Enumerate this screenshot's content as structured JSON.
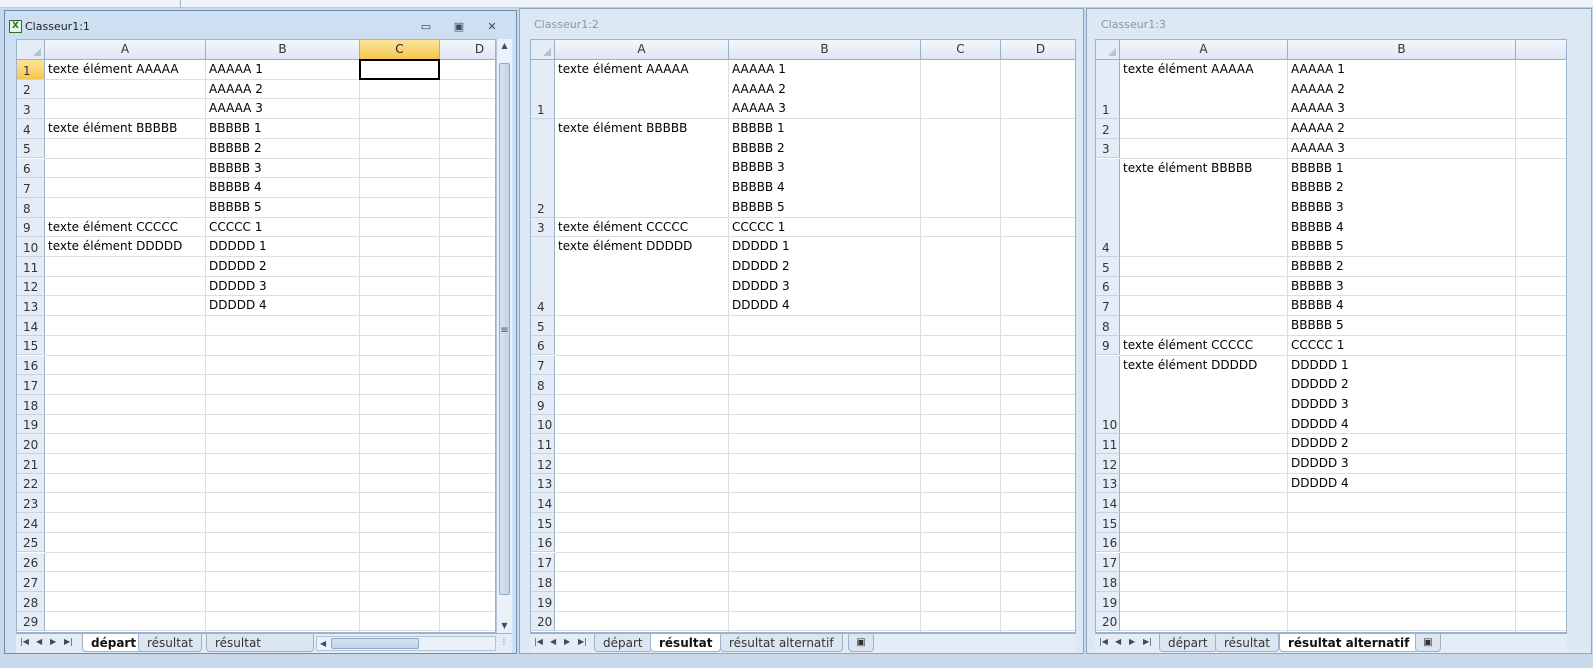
{
  "windows": [
    {
      "title": "Classeur1:1",
      "columns": [
        "A",
        "B",
        "C",
        "D"
      ],
      "rows": [
        "1",
        "2",
        "3",
        "4",
        "5",
        "6",
        "7",
        "8",
        "9",
        "10",
        "11",
        "12",
        "13",
        "14",
        "15",
        "16",
        "17",
        "18",
        "19",
        "20",
        "21",
        "22",
        "23",
        "24",
        "25",
        "26",
        "27",
        "28",
        "29"
      ],
      "cells": [
        {
          "r": 0,
          "c": 0,
          "lines": [
            "texte élément AAAAA"
          ]
        },
        {
          "r": 0,
          "c": 1,
          "lines": [
            "AAAAA 1"
          ]
        },
        {
          "r": 1,
          "c": 1,
          "lines": [
            "AAAAA 2"
          ]
        },
        {
          "r": 2,
          "c": 1,
          "lines": [
            "AAAAA 3"
          ]
        },
        {
          "r": 3,
          "c": 0,
          "lines": [
            "texte élément BBBBB"
          ]
        },
        {
          "r": 3,
          "c": 1,
          "lines": [
            "BBBBB 1"
          ]
        },
        {
          "r": 4,
          "c": 1,
          "lines": [
            "BBBBB 2"
          ]
        },
        {
          "r": 5,
          "c": 1,
          "lines": [
            "BBBBB 3"
          ]
        },
        {
          "r": 6,
          "c": 1,
          "lines": [
            "BBBBB 4"
          ]
        },
        {
          "r": 7,
          "c": 1,
          "lines": [
            "BBBBB 5"
          ]
        },
        {
          "r": 8,
          "c": 0,
          "lines": [
            "texte élément CCCCC"
          ]
        },
        {
          "r": 8,
          "c": 1,
          "lines": [
            "CCCCC 1"
          ]
        },
        {
          "r": 9,
          "c": 0,
          "lines": [
            "texte élément DDDDD"
          ]
        },
        {
          "r": 9,
          "c": 1,
          "lines": [
            "DDDDD 1"
          ]
        },
        {
          "r": 10,
          "c": 1,
          "lines": [
            "DDDDD 2"
          ]
        },
        {
          "r": 11,
          "c": 1,
          "lines": [
            "DDDDD 3"
          ]
        },
        {
          "r": 12,
          "c": 1,
          "lines": [
            "DDDDD 4"
          ]
        }
      ],
      "tabs": [
        "départ",
        "résultat",
        "résultat alternati"
      ],
      "active_tab": 0
    },
    {
      "title": "Classeur1:2",
      "columns": [
        "A",
        "B",
        "C",
        "D"
      ],
      "rows": [
        "1",
        "2",
        "3",
        "4",
        "5",
        "6",
        "7",
        "8",
        "9",
        "10",
        "11",
        "12",
        "13",
        "14",
        "15",
        "16",
        "17",
        "18",
        "19",
        "20"
      ],
      "cells": [
        {
          "r": 0,
          "c": 0,
          "lines": [
            "texte élément AAAAA"
          ]
        },
        {
          "r": 0,
          "c": 1,
          "lines": [
            "AAAAA 1",
            "AAAAA 2",
            "AAAAA 3"
          ]
        },
        {
          "r": 1,
          "c": 0,
          "lines": [
            "texte élément BBBBB"
          ]
        },
        {
          "r": 1,
          "c": 1,
          "lines": [
            "BBBBB 1",
            "BBBBB 2",
            "BBBBB 3",
            "BBBBB 4",
            "BBBBB 5"
          ]
        },
        {
          "r": 2,
          "c": 0,
          "lines": [
            "texte élément CCCCC"
          ]
        },
        {
          "r": 2,
          "c": 1,
          "lines": [
            "CCCCC 1"
          ]
        },
        {
          "r": 3,
          "c": 0,
          "lines": [
            "texte élément DDDDD"
          ]
        },
        {
          "r": 3,
          "c": 1,
          "lines": [
            "DDDDD 1",
            "DDDDD 2",
            "DDDDD 3",
            "DDDDD 4"
          ]
        }
      ],
      "tabs": [
        "départ",
        "résultat",
        "résultat alternatif"
      ],
      "active_tab": 1
    },
    {
      "title": "Classeur1:3",
      "columns": [
        "A",
        "B",
        ""
      ],
      "rows": [
        "1",
        "2",
        "3",
        "4",
        "5",
        "6",
        "7",
        "8",
        "9",
        "10",
        "11",
        "12",
        "13",
        "14",
        "15",
        "16",
        "17",
        "18",
        "19",
        "20"
      ],
      "cells": [
        {
          "r": 0,
          "c": 0,
          "lines": [
            "texte élément AAAAA"
          ]
        },
        {
          "r": 0,
          "c": 1,
          "lines": [
            "AAAAA 1",
            "AAAAA 2",
            "AAAAA 3"
          ]
        },
        {
          "r": 1,
          "c": 1,
          "lines": [
            "AAAAA 2"
          ]
        },
        {
          "r": 2,
          "c": 1,
          "lines": [
            "AAAAA 3"
          ]
        },
        {
          "r": 3,
          "c": 0,
          "lines": [
            "texte élément BBBBB"
          ]
        },
        {
          "r": 3,
          "c": 1,
          "lines": [
            "BBBBB 1",
            "BBBBB 2",
            "BBBBB 3",
            "BBBBB 4",
            "BBBBB 5"
          ]
        },
        {
          "r": 4,
          "c": 1,
          "lines": [
            "BBBBB 2"
          ]
        },
        {
          "r": 5,
          "c": 1,
          "lines": [
            "BBBBB 3"
          ]
        },
        {
          "r": 6,
          "c": 1,
          "lines": [
            "BBBBB 4"
          ]
        },
        {
          "r": 7,
          "c": 1,
          "lines": [
            "BBBBB 5"
          ]
        },
        {
          "r": 8,
          "c": 0,
          "lines": [
            "texte élément CCCCC"
          ]
        },
        {
          "r": 8,
          "c": 1,
          "lines": [
            "CCCCC 1"
          ]
        },
        {
          "r": 9,
          "c": 0,
          "lines": [
            "texte élément DDDDD"
          ]
        },
        {
          "r": 9,
          "c": 1,
          "lines": [
            "DDDDD 1",
            "DDDDD 2",
            "DDDDD 3",
            "DDDDD 4"
          ]
        },
        {
          "r": 10,
          "c": 1,
          "lines": [
            "DDDDD 2"
          ]
        },
        {
          "r": 11,
          "c": 1,
          "lines": [
            "DDDDD 3"
          ]
        },
        {
          "r": 12,
          "c": 1,
          "lines": [
            "DDDDD 4"
          ]
        }
      ],
      "tabs": [
        "départ",
        "résultat",
        "résultat alternatif"
      ],
      "active_tab": 2
    }
  ],
  "icons": {
    "excel": "X",
    "minimize": "▭",
    "restore": "▣",
    "close": "✕",
    "nav": [
      "|◀",
      "◀",
      "▶",
      "▶|"
    ],
    "new_sheet": "▣",
    "scroll_up": "▲",
    "scroll_down": "▼",
    "scroll_left": "◀",
    "split": "≡",
    "grip": "⋮"
  },
  "colors": {
    "selected_header": "#f6c64c",
    "header_bg": "#e4ecf7",
    "gridline": "#dadfe6"
  }
}
